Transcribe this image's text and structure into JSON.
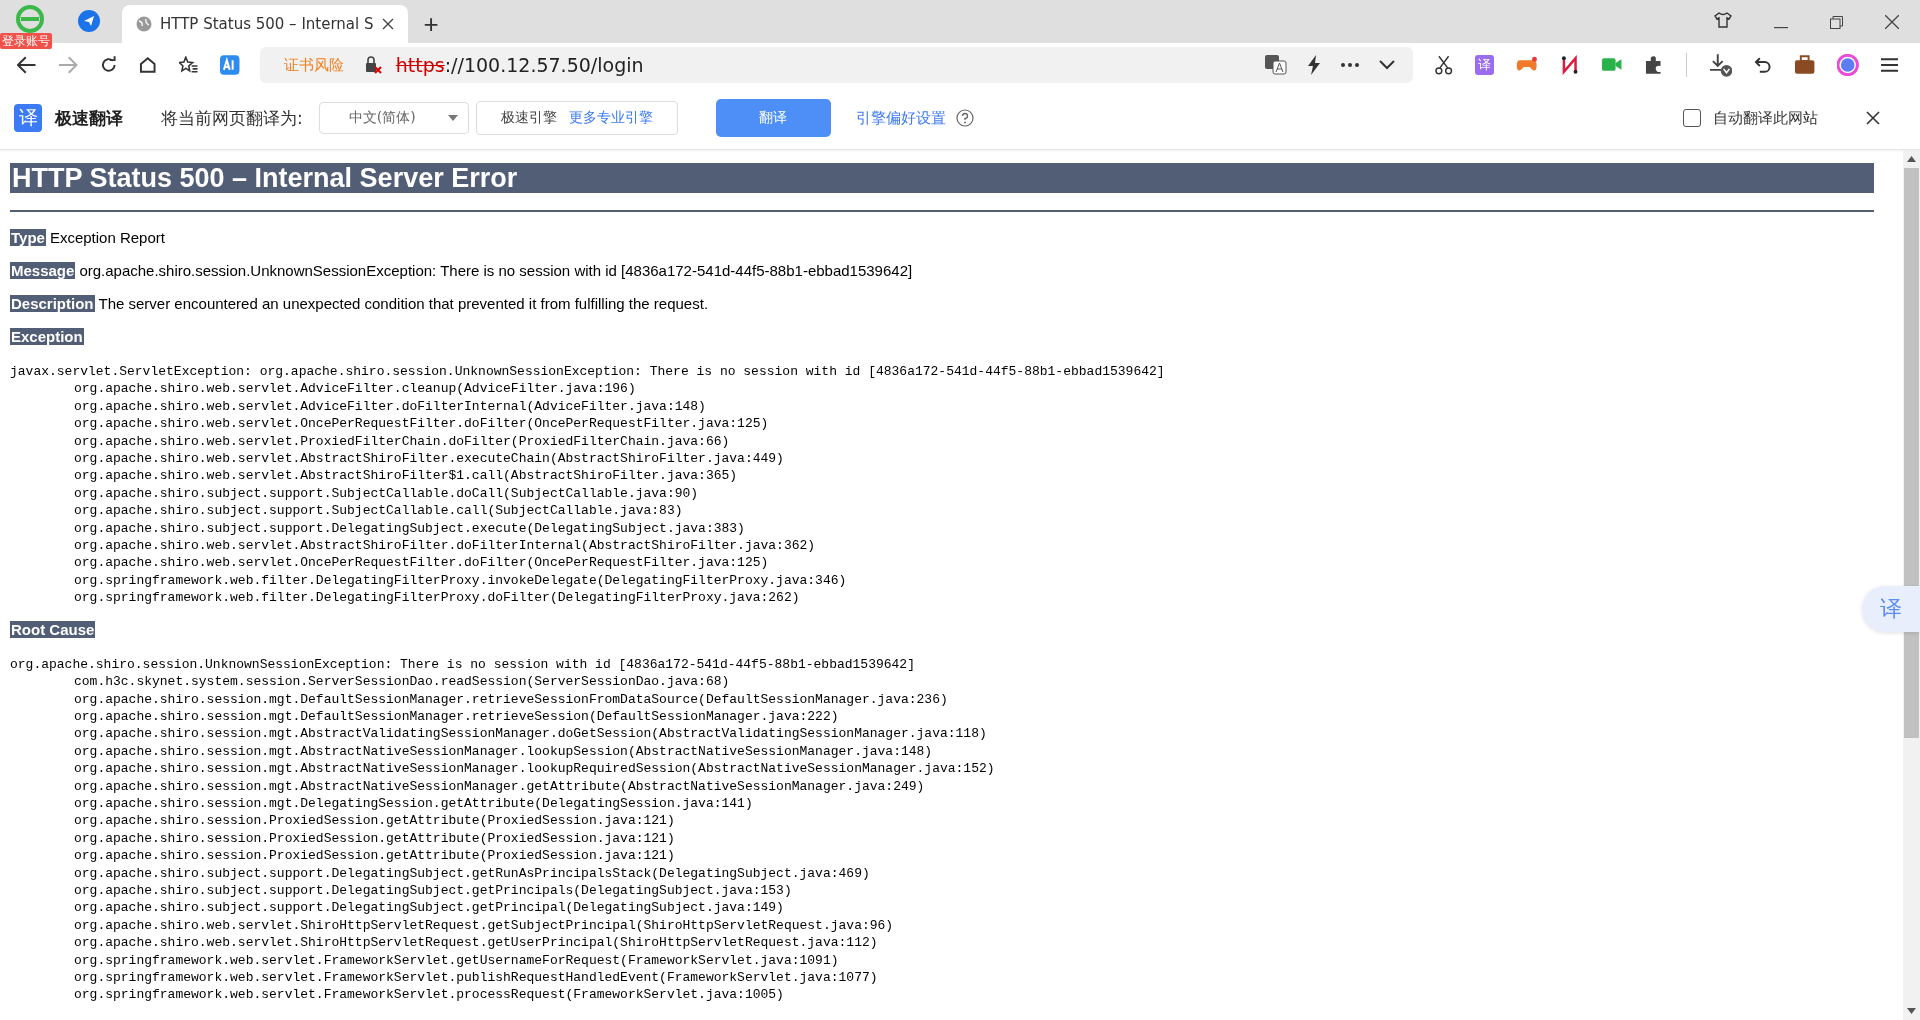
{
  "browser": {
    "login_badge": "登录账号",
    "tabs": [
      {
        "title": "HTTP Status 500 – Internal S",
        "selected": true
      }
    ],
    "new_tab": "+",
    "address": {
      "security_warning": "证书风险",
      "scheme": "https",
      "rest": "://100.12.57.50/login"
    },
    "extension_label": "译"
  },
  "translate_bar": {
    "logo": "译",
    "brand": "极速翻译",
    "prompt": "将当前网页翻译为:",
    "language": "中文(简体)",
    "engine": "极速引擎",
    "engine_link": "更多专业引擎",
    "translate_button": "翻译",
    "settings_link": "引擎偏好设置",
    "auto_translate": {
      "label": "自动翻译此网站",
      "checked": false
    },
    "float_button": "译"
  },
  "page": {
    "title": "HTTP Status 500 – Internal Server Error",
    "fields": [
      {
        "label": "Type",
        "value": "Exception Report"
      },
      {
        "label": "Message",
        "value": "org.apache.shiro.session.UnknownSessionException: There is no session with id [4836a172-541d-44f5-88b1-ebbad1539642]"
      },
      {
        "label": "Description",
        "value": "The server encountered an unexpected condition that prevented it from fulfilling the request."
      }
    ],
    "sections": [
      {
        "heading": "Exception",
        "exception": "javax.servlet.ServletException: org.apache.shiro.session.UnknownSessionException: There is no session with id [4836a172-541d-44f5-88b1-ebbad1539642]",
        "frames": [
          "org.apache.shiro.web.servlet.AdviceFilter.cleanup(AdviceFilter.java:196)",
          "org.apache.shiro.web.servlet.AdviceFilter.doFilterInternal(AdviceFilter.java:148)",
          "org.apache.shiro.web.servlet.OncePerRequestFilter.doFilter(OncePerRequestFilter.java:125)",
          "org.apache.shiro.web.servlet.ProxiedFilterChain.doFilter(ProxiedFilterChain.java:66)",
          "org.apache.shiro.web.servlet.AbstractShiroFilter.executeChain(AbstractShiroFilter.java:449)",
          "org.apache.shiro.web.servlet.AbstractShiroFilter$1.call(AbstractShiroFilter.java:365)",
          "org.apache.shiro.subject.support.SubjectCallable.doCall(SubjectCallable.java:90)",
          "org.apache.shiro.subject.support.SubjectCallable.call(SubjectCallable.java:83)",
          "org.apache.shiro.subject.support.DelegatingSubject.execute(DelegatingSubject.java:383)",
          "org.apache.shiro.web.servlet.AbstractShiroFilter.doFilterInternal(AbstractShiroFilter.java:362)",
          "org.apache.shiro.web.servlet.OncePerRequestFilter.doFilter(OncePerRequestFilter.java:125)",
          "org.springframework.web.filter.DelegatingFilterProxy.invokeDelegate(DelegatingFilterProxy.java:346)",
          "org.springframework.web.filter.DelegatingFilterProxy.doFilter(DelegatingFilterProxy.java:262)"
        ]
      },
      {
        "heading": "Root Cause",
        "exception": "org.apache.shiro.session.UnknownSessionException: There is no session with id [4836a172-541d-44f5-88b1-ebbad1539642]",
        "frames": [
          "com.h3c.skynet.system.session.ServerSessionDao.readSession(ServerSessionDao.java:68)",
          "org.apache.shiro.session.mgt.DefaultSessionManager.retrieveSessionFromDataSource(DefaultSessionManager.java:236)",
          "org.apache.shiro.session.mgt.DefaultSessionManager.retrieveSession(DefaultSessionManager.java:222)",
          "org.apache.shiro.session.mgt.AbstractValidatingSessionManager.doGetSession(AbstractValidatingSessionManager.java:118)",
          "org.apache.shiro.session.mgt.AbstractNativeSessionManager.lookupSession(AbstractNativeSessionManager.java:148)",
          "org.apache.shiro.session.mgt.AbstractNativeSessionManager.lookupRequiredSession(AbstractNativeSessionManager.java:152)",
          "org.apache.shiro.session.mgt.AbstractNativeSessionManager.getAttribute(AbstractNativeSessionManager.java:249)",
          "org.apache.shiro.session.mgt.DelegatingSession.getAttribute(DelegatingSession.java:141)",
          "org.apache.shiro.session.ProxiedSession.getAttribute(ProxiedSession.java:121)",
          "org.apache.shiro.session.ProxiedSession.getAttribute(ProxiedSession.java:121)",
          "org.apache.shiro.session.ProxiedSession.getAttribute(ProxiedSession.java:121)",
          "org.apache.shiro.subject.support.DelegatingSubject.getRunAsPrincipalsStack(DelegatingSubject.java:469)",
          "org.apache.shiro.subject.support.DelegatingSubject.getPrincipals(DelegatingSubject.java:153)",
          "org.apache.shiro.subject.support.DelegatingSubject.getPrincipal(DelegatingSubject.java:149)",
          "org.apache.shiro.web.servlet.ShiroHttpServletRequest.getSubjectPrincipal(ShiroHttpServletRequest.java:96)",
          "org.apache.shiro.web.servlet.ShiroHttpServletRequest.getUserPrincipal(ShiroHttpServletRequest.java:112)",
          "org.springframework.web.servlet.FrameworkServlet.getUsernameForRequest(FrameworkServlet.java:1091)",
          "org.springframework.web.servlet.FrameworkServlet.publishRequestHandledEvent(FrameworkServlet.java:1077)",
          "org.springframework.web.servlet.FrameworkServlet.processRequest(FrameworkServlet.java:1005)"
        ]
      }
    ]
  }
}
